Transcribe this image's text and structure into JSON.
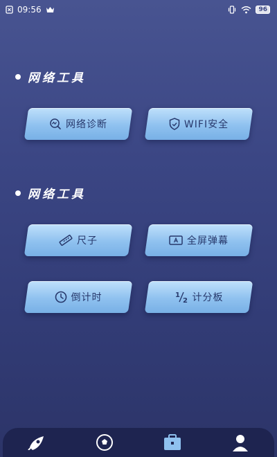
{
  "status_bar": {
    "time": "09:56",
    "battery": "96",
    "icons": [
      "sim-icon",
      "crown-icon",
      "vibrate-icon",
      "wifi-icon",
      "battery-icon"
    ]
  },
  "sections": [
    {
      "title": "网络工具",
      "tools": [
        {
          "label": "网络诊断",
          "icon": "network-diagnosis-icon"
        },
        {
          "label": "WIFI安全",
          "icon": "shield-icon"
        }
      ]
    },
    {
      "title": "网络工具",
      "tools": [
        {
          "label": "尺子",
          "icon": "ruler-icon"
        },
        {
          "label": "全屏弹幕",
          "icon": "fullscreen-text-icon"
        },
        {
          "label": "倒计时",
          "icon": "clock-icon"
        },
        {
          "label": "计分板",
          "icon": "half-fraction-icon"
        }
      ]
    }
  ],
  "bottom_nav": {
    "items": [
      {
        "icon": "rocket-icon"
      },
      {
        "icon": "ball-icon"
      },
      {
        "icon": "toolbox-icon",
        "active": true
      },
      {
        "icon": "user-icon"
      }
    ]
  },
  "colors": {
    "background_top": "#485491",
    "background_bottom": "#2c3468",
    "button_light": "#bfe0fb",
    "button_dark": "#78b0e6",
    "button_text": "#27386b",
    "nav_bg": "#1e2450",
    "nav_active": "#8fc1ef"
  }
}
